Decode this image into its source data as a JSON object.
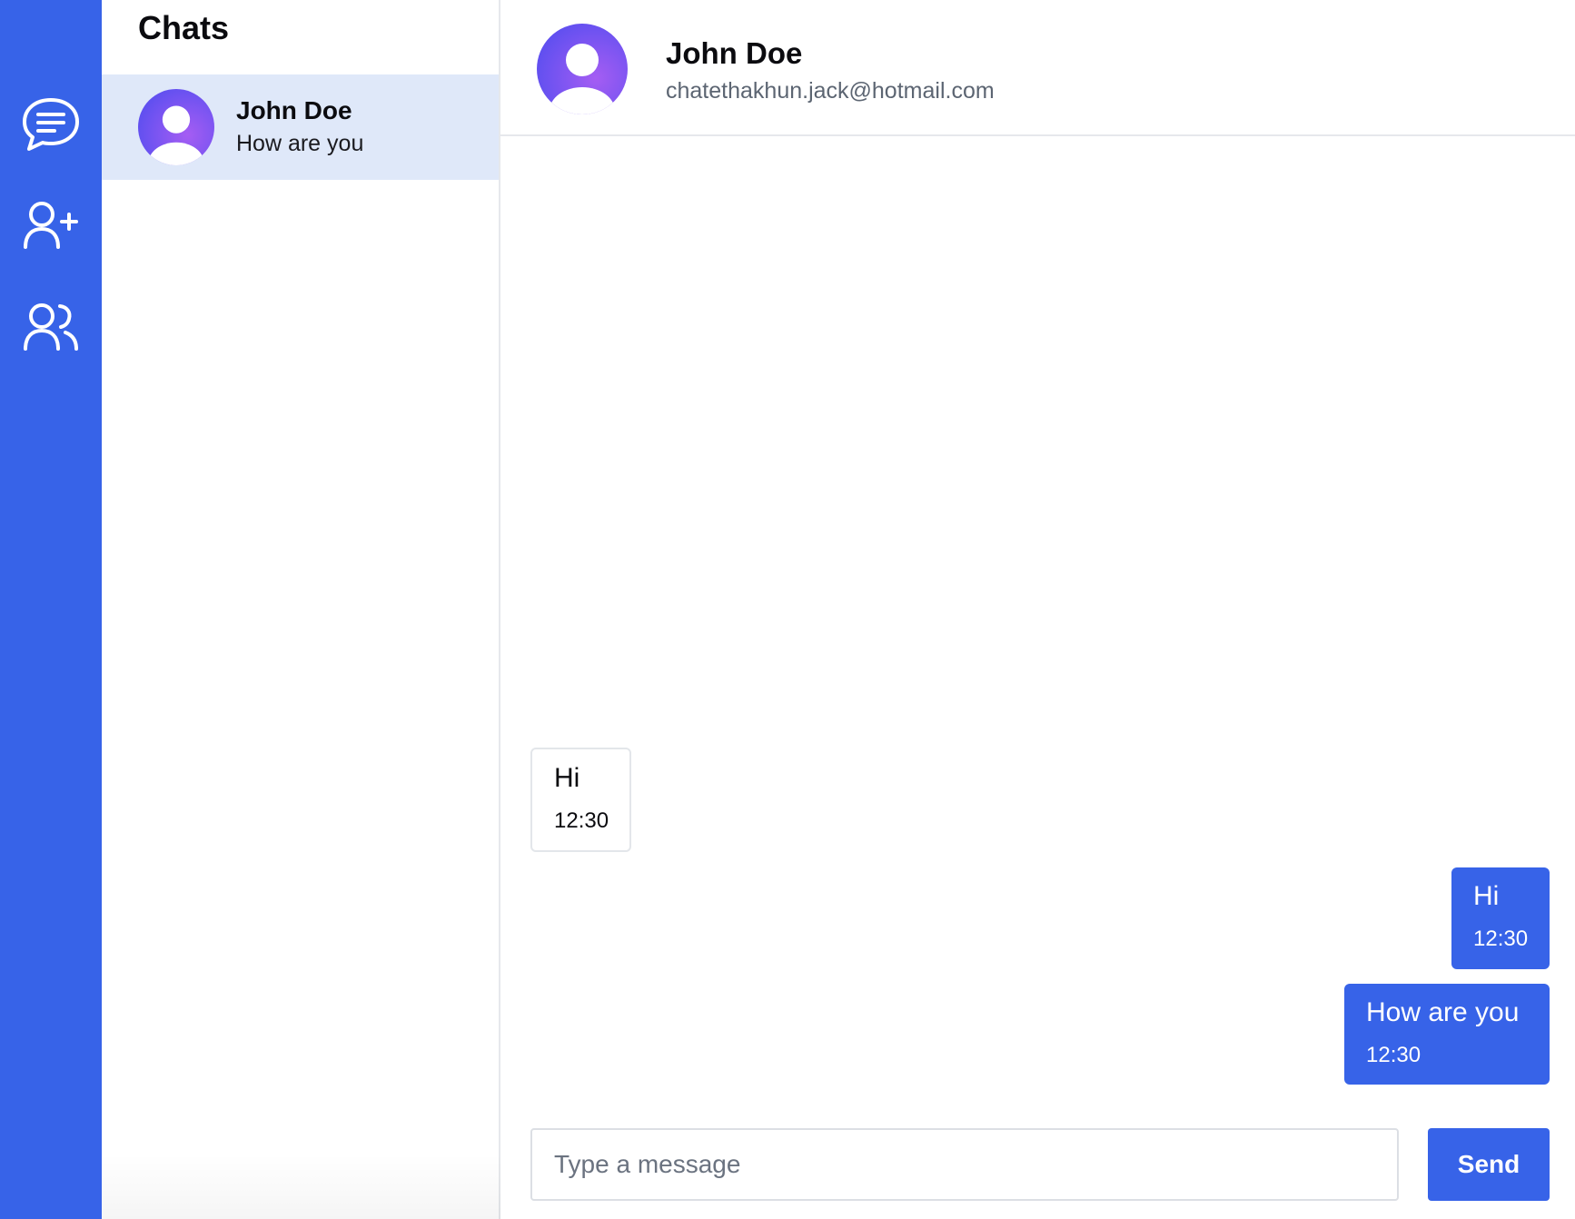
{
  "colors": {
    "primary": "#3763e8",
    "selected_chat_bg": "#dfe8f9",
    "avatar_gradient_start": "#6a4cf0",
    "avatar_gradient_end": "#a05cf2"
  },
  "rail": {
    "items": [
      {
        "icon": "chat-bubble-icon"
      },
      {
        "icon": "add-user-icon"
      },
      {
        "icon": "users-icon"
      }
    ]
  },
  "chatlist": {
    "title": "Chats",
    "items": [
      {
        "name": "John Doe",
        "preview": "How are you",
        "avatar": "avatar-icon"
      }
    ]
  },
  "conversation": {
    "contact_name": "John Doe",
    "contact_email": "chatethakhun.jack@hotmail.com",
    "messages": [
      {
        "direction": "incoming",
        "text": "Hi",
        "time": "12:30"
      },
      {
        "direction": "outgoing",
        "text": "Hi",
        "time": "12:30"
      },
      {
        "direction": "outgoing",
        "text": "How are you",
        "time": "12:30"
      }
    ]
  },
  "composer": {
    "placeholder": "Type a message",
    "value": "",
    "send_label": "Send"
  }
}
